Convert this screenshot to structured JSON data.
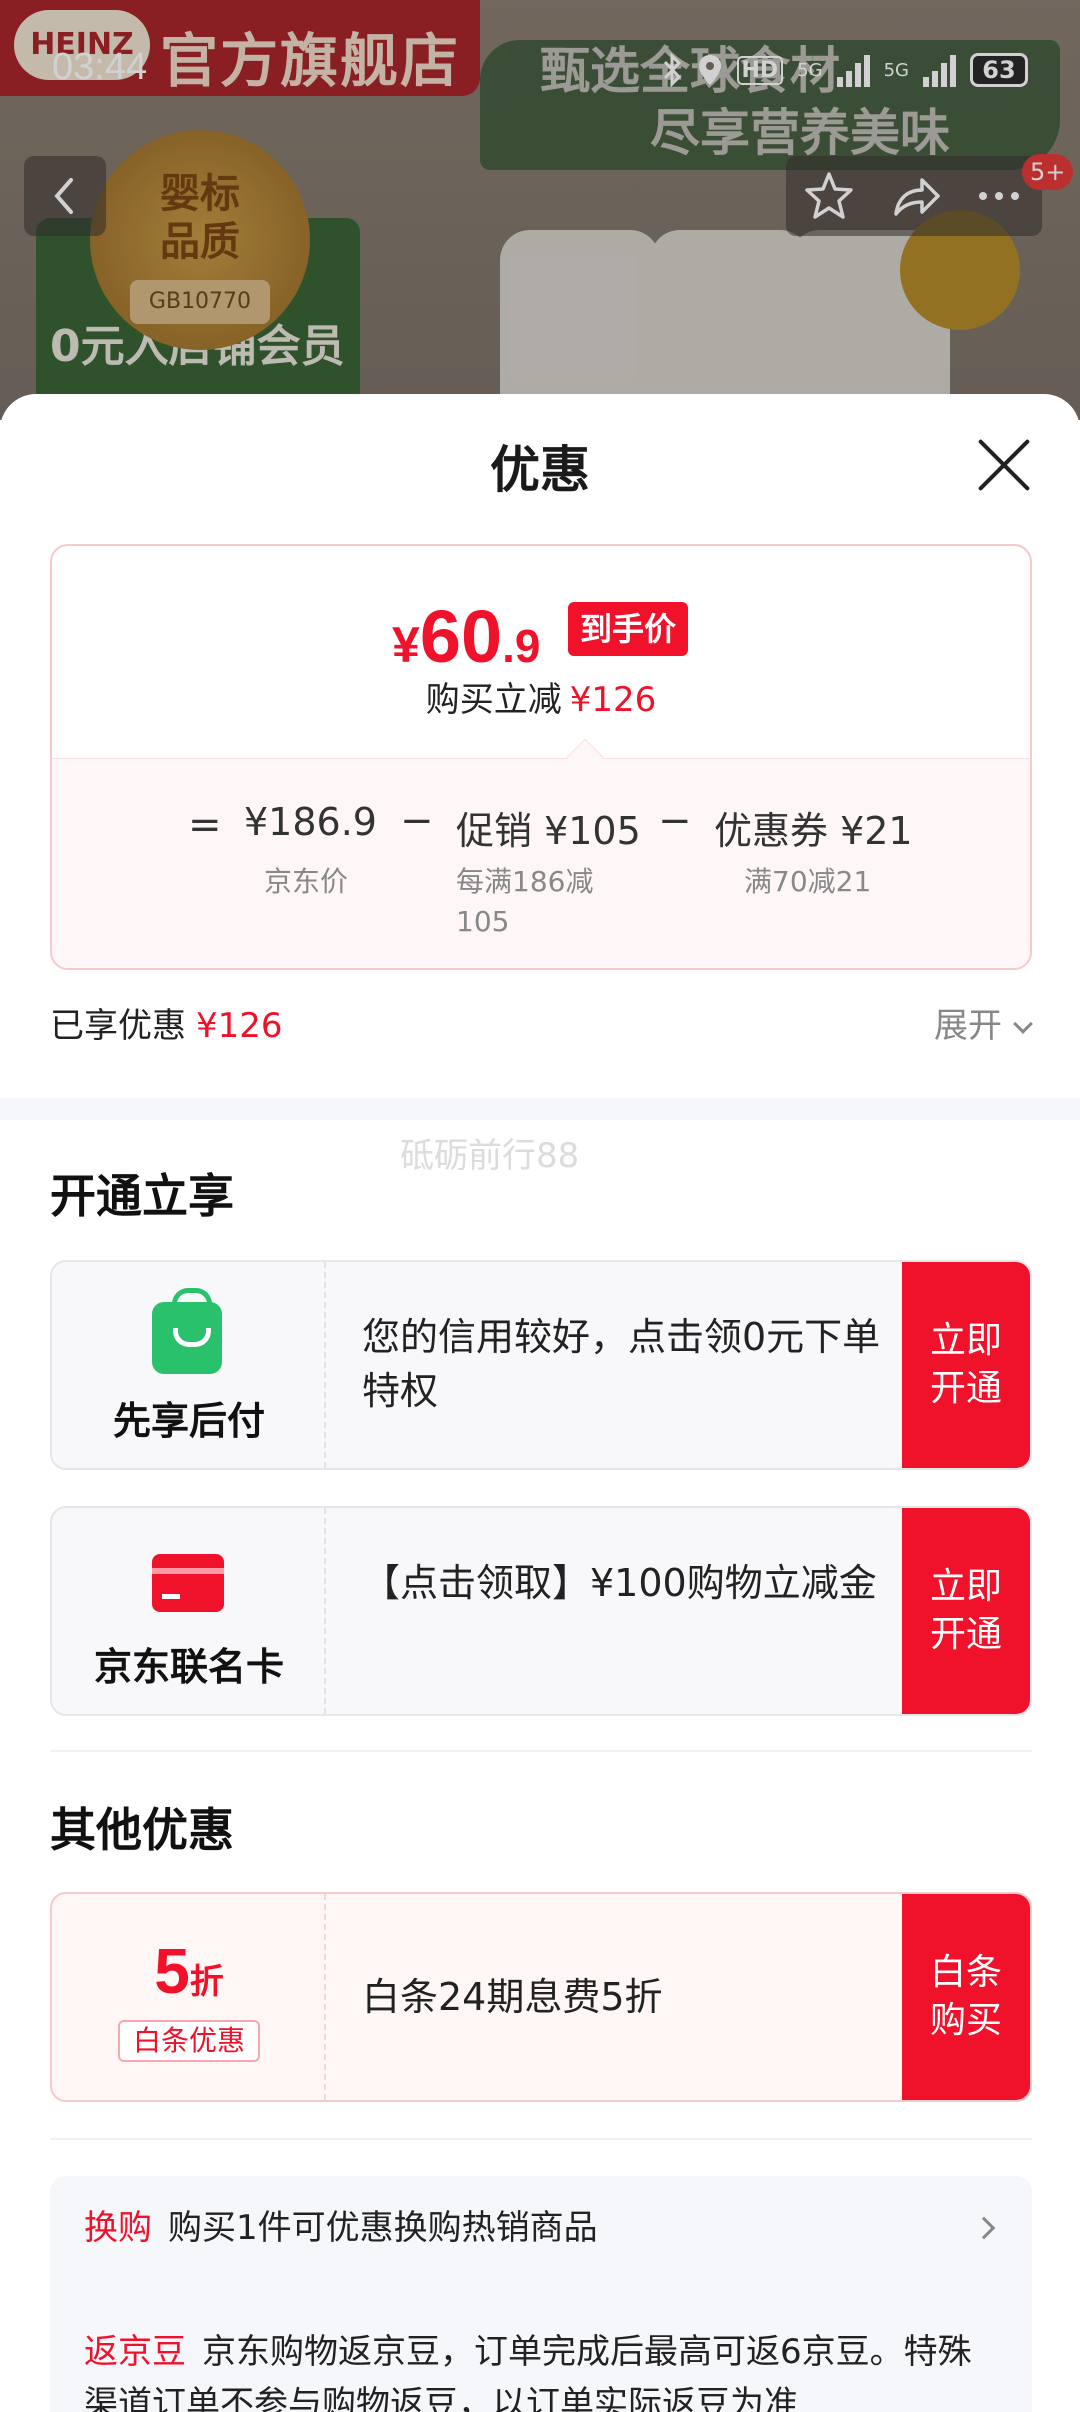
{
  "status_bar": {
    "time": "03:44",
    "hd": "HD",
    "net1": "5G",
    "net2": "5G",
    "battery": "63"
  },
  "background": {
    "brand": "HEINZ",
    "store_name": "官方旗舰店",
    "slogan_line1": "甄选全球食材",
    "slogan_line2": "尽享营养美味",
    "medal_line1": "婴标",
    "medal_line2": "品质",
    "medal_code": "GB10770",
    "member_banner": "0元入店铺会员",
    "badge": "5+"
  },
  "sheet": {
    "title": "优惠",
    "price": {
      "yen": "¥",
      "integer": "60",
      "decimal": ".9",
      "tag": "到手价",
      "saved_label": "购买立减",
      "saved_value": "¥126"
    },
    "breakdown": {
      "eq": "=",
      "jd_price": "¥186.9",
      "jd_price_label": "京东价",
      "minus1": "−",
      "promo": "促销 ¥105",
      "promo_desc_line1": "每满186减",
      "promo_desc_line2": "105",
      "minus2": "−",
      "coupon": "优惠券 ¥21",
      "coupon_desc": "满70减21"
    },
    "enjoyed_label": "已享优惠",
    "enjoyed_value": "¥126",
    "expand_label": "展开",
    "watermark": "砥砺前行88",
    "section_open": "开通立享",
    "offers": [
      {
        "name": "先享后付",
        "desc": "您的信用较好，点击领0元下单特权",
        "cta": "立即开通"
      },
      {
        "name": "京东联名卡",
        "desc": "【点击领取】¥100购物立减金",
        "cta": "立即开通"
      }
    ],
    "section_other": "其他优惠",
    "baitiao": {
      "discount_num": "5",
      "discount_unit": "折",
      "tag": "白条优惠",
      "desc": "白条24期息费5折",
      "cta": "白条购买"
    },
    "info": {
      "swap_label": "换购",
      "swap_text": "购买1件可优惠换购热销商品",
      "bean_label": "返京豆",
      "bean_text": "京东购物返京豆，订单完成后最高可返6京豆。特殊渠道订单不参与购物返豆，以订单实际返豆为准"
    }
  },
  "colors": {
    "accent_red": "#f0112a",
    "green": "#29c16b"
  }
}
